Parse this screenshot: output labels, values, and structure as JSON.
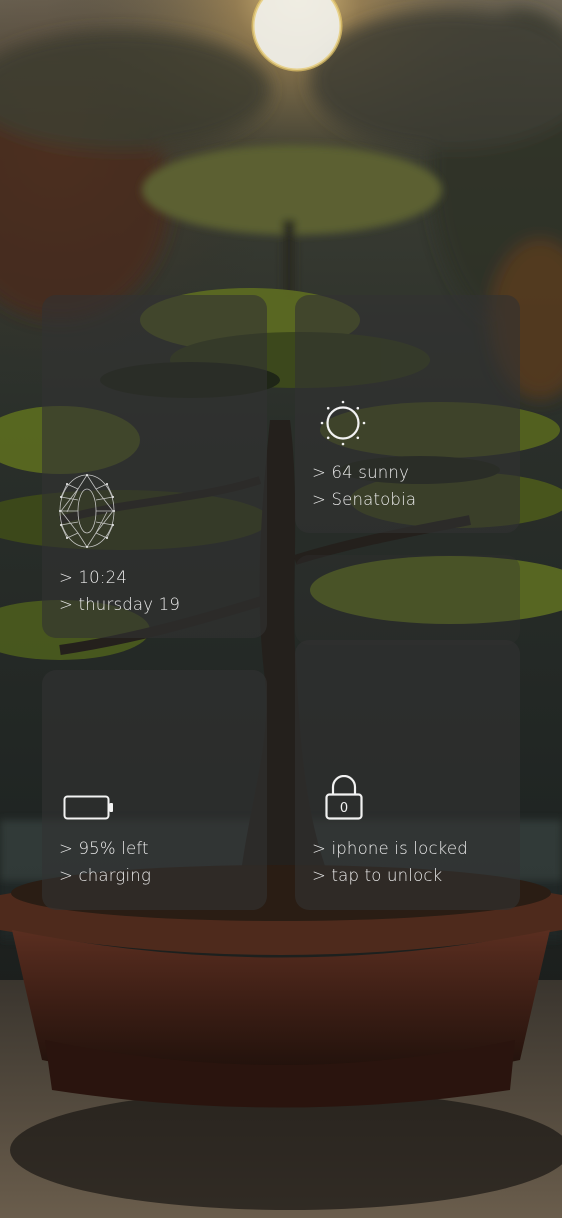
{
  "clock_widget": {
    "time_line": "> 10:24",
    "date_line": "> thursday 19",
    "icon": "geometric-zero-icon"
  },
  "weather_widget": {
    "temp_line": "> 64 sunny",
    "location_line": "> Senatobia",
    "icon": "sun-icon"
  },
  "battery_widget": {
    "level_line": "> 95% left",
    "status_line": "> charging",
    "icon": "battery-icon",
    "level": 0.95
  },
  "lock_widget": {
    "status_line": "> iphone is locked",
    "hint_line": "> tap to unlock",
    "icon": "lock-icon",
    "icon_glyph": "0"
  },
  "colors": {
    "text": "#ececec",
    "card": "#323232",
    "foliage": "#6b7a2a"
  }
}
